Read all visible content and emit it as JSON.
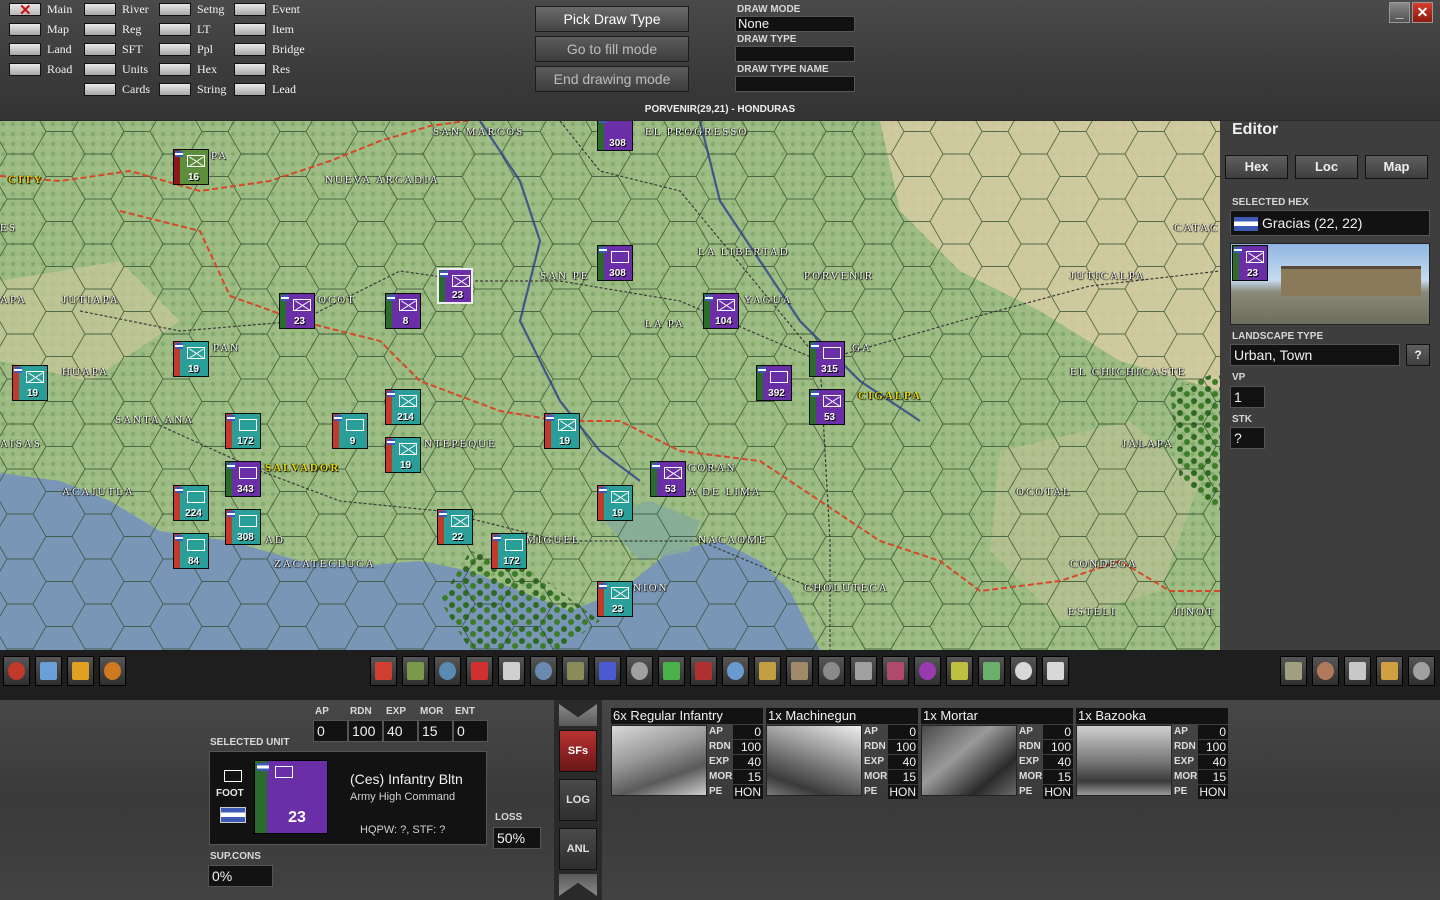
{
  "layers": [
    {
      "label": "Main",
      "on": true
    },
    {
      "label": "Map",
      "on": false
    },
    {
      "label": "Land",
      "on": false
    },
    {
      "label": "Road",
      "on": false
    },
    {
      "label": "River",
      "on": false
    },
    {
      "label": "Reg",
      "on": false
    },
    {
      "label": "SFT",
      "on": false
    },
    {
      "label": "Units",
      "on": false
    },
    {
      "label": "Cards",
      "on": false
    },
    {
      "label": "Setng",
      "on": false
    },
    {
      "label": "LT",
      "on": false
    },
    {
      "label": "Ppl",
      "on": false
    },
    {
      "label": "Hex",
      "on": false
    },
    {
      "label": "String",
      "on": false
    },
    {
      "label": "Event",
      "on": false
    },
    {
      "label": "Item",
      "on": false
    },
    {
      "label": "Bridge",
      "on": false
    },
    {
      "label": "Res",
      "on": false
    },
    {
      "label": "Lead",
      "on": false
    }
  ],
  "draw": {
    "pick_label": "Pick Draw Type",
    "fill_label": "Go to fill mode",
    "end_label": "End drawing mode",
    "mode_label": "DRAW MODE",
    "mode_value": "None",
    "type_label": "DRAW TYPE",
    "type_value": "",
    "type_name_label": "DRAW TYPE NAME",
    "type_name_value": ""
  },
  "window": {
    "minimize": "_",
    "close": "✕"
  },
  "map_title": "PORVENIR(29,21) - HONDURAS",
  "towns": [
    {
      "name": "SAN MARCOS",
      "cap": false
    },
    {
      "name": "EL PROGRESSO",
      "cap": false
    },
    {
      "name": "PA",
      "cap": false
    },
    {
      "name": "CITY",
      "cap": true
    },
    {
      "name": "NUEVA ARCADIA",
      "cap": false
    },
    {
      "name": "ES",
      "cap": false
    },
    {
      "name": "LA LIBERTAD",
      "cap": false
    },
    {
      "name": "PORVENIR",
      "cap": false
    },
    {
      "name": "SAN PE",
      "cap": false
    },
    {
      "name": "JUTICALPA",
      "cap": false
    },
    {
      "name": "CATAC",
      "cap": false
    },
    {
      "name": "APA",
      "cap": false
    },
    {
      "name": "JUTIAPA",
      "cap": false
    },
    {
      "name": "OCOT",
      "cap": false
    },
    {
      "name": "YAGUA",
      "cap": false
    },
    {
      "name": "LA PA",
      "cap": false
    },
    {
      "name": "GA",
      "cap": false
    },
    {
      "name": "PAN",
      "cap": false
    },
    {
      "name": "HUAPA",
      "cap": false
    },
    {
      "name": "EL CHICHICASTE",
      "cap": false
    },
    {
      "name": "CIGALPA",
      "cap": true
    },
    {
      "name": "SANTA ANA",
      "cap": false
    },
    {
      "name": "AISAS",
      "cap": false
    },
    {
      "name": "NTEPEQUE",
      "cap": false
    },
    {
      "name": "JALAPA",
      "cap": false
    },
    {
      "name": "SALVADOR",
      "cap": true
    },
    {
      "name": "CORAN",
      "cap": false
    },
    {
      "name": "ACAJUTLA",
      "cap": false
    },
    {
      "name": "A DE LIMA",
      "cap": false
    },
    {
      "name": "OCOTAL",
      "cap": false
    },
    {
      "name": "AD",
      "cap": false
    },
    {
      "name": "MIGUEL",
      "cap": false
    },
    {
      "name": "NACAOME",
      "cap": false
    },
    {
      "name": "ZACATECLUCA",
      "cap": false
    },
    {
      "name": "CONDEGA",
      "cap": false
    },
    {
      "name": "NION",
      "cap": false
    },
    {
      "name": "CHOLUTECA",
      "cap": false
    },
    {
      "name": "ESTELI",
      "cap": false
    },
    {
      "name": "JINOT",
      "cap": false
    }
  ],
  "units": [
    {
      "num": "308",
      "color": "#6a2fa6"
    },
    {
      "num": "16",
      "color": "#5d8e3b"
    },
    {
      "num": "23",
      "color": "#6a2fa6"
    },
    {
      "num": "308",
      "color": "#6a2fa6"
    },
    {
      "num": "23",
      "color": "#6a2fa6"
    },
    {
      "num": "8",
      "color": "#6a2fa6"
    },
    {
      "num": "104",
      "color": "#6a2fa6"
    },
    {
      "num": "19",
      "color": "#2a9e98"
    },
    {
      "num": "315",
      "color": "#6a2fa6"
    },
    {
      "num": "19",
      "color": "#2a9e98"
    },
    {
      "num": "392",
      "color": "#6a2fa6"
    },
    {
      "num": "214",
      "color": "#2a9e98"
    },
    {
      "num": "53",
      "color": "#6a2fa6"
    },
    {
      "num": "172",
      "color": "#2a9e98"
    },
    {
      "num": "9",
      "color": "#2a9e98"
    },
    {
      "num": "19",
      "color": "#2a9e98"
    },
    {
      "num": "19",
      "color": "#2a9e98"
    },
    {
      "num": "343",
      "color": "#6a2fa6"
    },
    {
      "num": "53",
      "color": "#6a2fa6"
    },
    {
      "num": "224",
      "color": "#2a9e98"
    },
    {
      "num": "308",
      "color": "#2a9e98"
    },
    {
      "num": "19",
      "color": "#2a9e98"
    },
    {
      "num": "22",
      "color": "#2a9e98"
    },
    {
      "num": "172",
      "color": "#2a9e98"
    },
    {
      "num": "84",
      "color": "#2a9e98"
    },
    {
      "num": "23",
      "color": "#2a9e98"
    }
  ],
  "editor": {
    "title": "Editor",
    "tabs": [
      "Hex",
      "Loc",
      "Map"
    ],
    "selected_hex_label": "SELECTED HEX",
    "selected_hex_value": "Gracias (22, 22)",
    "hex_unit_num": "23",
    "landscape_label": "LANDSCAPE TYPE",
    "landscape_value": "Urban, Town",
    "help": "?",
    "vp_label": "VP",
    "vp_value": "1",
    "stk_label": "STK",
    "stk_value": "?"
  },
  "selected_unit": {
    "header": "SELECTED UNIT",
    "stats": [
      {
        "label": "AP",
        "value": "0"
      },
      {
        "label": "RDN",
        "value": "100"
      },
      {
        "label": "EXP",
        "value": "40"
      },
      {
        "label": "MOR",
        "value": "15"
      },
      {
        "label": "ENT",
        "value": "0"
      }
    ],
    "move_type": "FOOT",
    "counter_num": "23",
    "name": "(Ces) Infantry Bltn",
    "command": "Army High Command",
    "hq": "HQPW: ?, STF: ?",
    "loss_label": "LOSS",
    "loss_value": "50%",
    "supcons_label": "SUP.CONS",
    "supcons_value": "0%"
  },
  "side_buttons": [
    "SFs",
    "LOG",
    "ANL"
  ],
  "subformations": [
    {
      "name": "6x Regular Infantry",
      "AP": "0",
      "RDN": "100",
      "EXP": "40",
      "MOR": "15",
      "PE": "HON"
    },
    {
      "name": "1x Machinegun",
      "AP": "0",
      "RDN": "100",
      "EXP": "40",
      "MOR": "15",
      "PE": "HON"
    },
    {
      "name": "1x Mortar",
      "AP": "0",
      "RDN": "100",
      "EXP": "40",
      "MOR": "15",
      "PE": "HON"
    },
    {
      "name": "1x Bazooka",
      "AP": "0",
      "RDN": "100",
      "EXP": "40",
      "MOR": "15",
      "PE": "HON"
    }
  ],
  "sf_stat_labels": {
    "AP": "AP",
    "RDN": "RDN",
    "EXP": "EXP",
    "MOR": "MOR",
    "PE": "PE"
  },
  "colors": {
    "accent": "#e8d800",
    "ally": "#2a9e98",
    "enemy": "#6a2fa6",
    "flag_blue": "#3d5bb5"
  },
  "toolbar_icons": [
    "undo-icon",
    "computer-icon",
    "hq-icon",
    "factory-icon",
    "pencil-icon",
    "unit-move-icon",
    "unit-swap-icon",
    "hq-flag-icon",
    "skull-icon",
    "hammer-icon",
    "anvil-icon",
    "boot-icon",
    "stamp-icon",
    "add-unit-icon",
    "remove-unit-icon",
    "crossed-swords-icon",
    "map-lines-icon",
    "factory-build-icon",
    "ruler-icon",
    "crane-icon",
    "square-icon",
    "hexagon-icon",
    "card-icon",
    "card-x-icon",
    "zoom-in-icon",
    "zoom-out-icon",
    "hex-outline-icon",
    "flag-icon",
    "book-icon",
    "map-icon",
    "rifle-icon",
    "next-arrow-icon"
  ]
}
